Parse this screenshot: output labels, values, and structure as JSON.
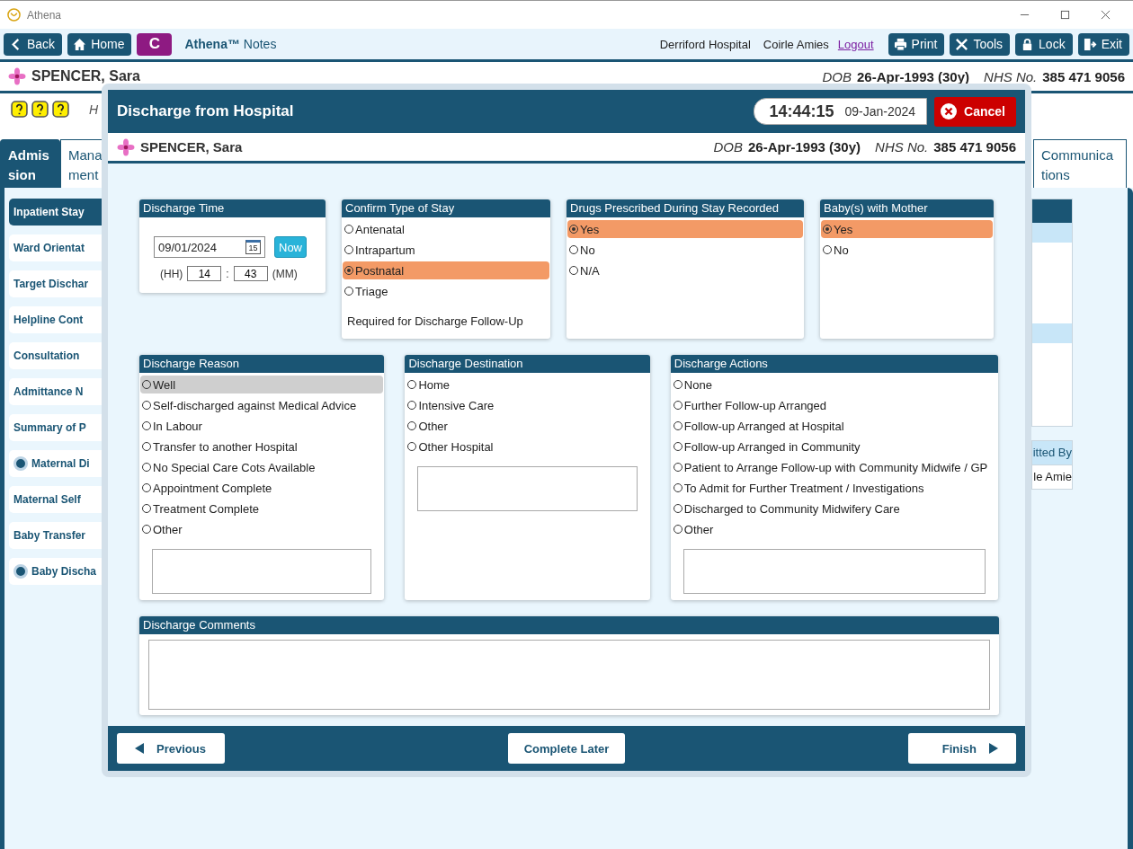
{
  "app": {
    "title": "Athena"
  },
  "toolbar": {
    "back": "Back",
    "home": "Home",
    "c": "C",
    "brand": "**Athena™** Notes",
    "hospital": "Derriford Hospital",
    "user": "Coirle Amies",
    "logout": "Logout",
    "print": "Print",
    "tools": "Tools",
    "lock": "Lock",
    "exit": "Exit"
  },
  "patient": {
    "name": "SPENCER, Sara",
    "dob_label": "DOB",
    "dob": "26-Apr-1993 (30y)",
    "nhs_label": "NHS No.",
    "nhs": "385 471 9056"
  },
  "info_row": {
    "text": "H"
  },
  "tabs": [
    {
      "label": "Admis sion",
      "selected": true
    },
    {
      "label": "Mana ment",
      "selected": false
    },
    {
      "label": "Communica tions",
      "selected": false
    }
  ],
  "sidebar": {
    "items": [
      {
        "label": "Inpatient Stay",
        "selected": true,
        "marked": false
      },
      {
        "label": "Ward Orientat",
        "selected": false,
        "marked": false
      },
      {
        "label": "Target Dischar",
        "selected": false,
        "marked": false
      },
      {
        "label": "Helpline Cont",
        "selected": false,
        "marked": false
      },
      {
        "label": "Consultation",
        "selected": false,
        "marked": false
      },
      {
        "label": "Admittance N",
        "selected": false,
        "marked": false
      },
      {
        "label": "Summary of P",
        "selected": false,
        "marked": false
      },
      {
        "label": "Maternal Di",
        "selected": false,
        "marked": true
      },
      {
        "label": "Maternal Self",
        "selected": false,
        "marked": false
      },
      {
        "label": "Baby Transfer",
        "selected": false,
        "marked": false
      },
      {
        "label": "Baby Discha",
        "selected": false,
        "marked": true
      }
    ]
  },
  "side_table": {
    "header": "itted By",
    "cell": "le Amie"
  },
  "modal": {
    "title": "Discharge from Hospital",
    "clock": {
      "time": "14:44:15",
      "date": "09-Jan-2024"
    },
    "cancel": "Cancel",
    "patient": {
      "name": "SPENCER, Sara",
      "dob_label": "DOB",
      "dob": "26-Apr-1993 (30y)",
      "nhs_label": "NHS No.",
      "nhs": "385 471 9056"
    },
    "discharge_time": {
      "title": "Discharge Time",
      "date": "09/01/2024",
      "calendar_day": "15",
      "now": "Now",
      "hh_label": "(HH)",
      "hh": "14",
      "separator": ":",
      "mm": "43",
      "mm_label": "(MM)"
    },
    "type_of_stay": {
      "title": "Confirm Type of Stay",
      "options": [
        {
          "label": "Antenatal",
          "selected": false
        },
        {
          "label": "Intrapartum",
          "selected": false
        },
        {
          "label": "Postnatal",
          "selected": true
        },
        {
          "label": "Triage",
          "selected": false
        }
      ],
      "note": "Required for Discharge Follow-Up"
    },
    "drugs": {
      "title": "Drugs Prescribed During Stay Recorded",
      "options": [
        {
          "label": "Yes",
          "selected": true
        },
        {
          "label": "No",
          "selected": false
        },
        {
          "label": "N/A",
          "selected": false
        }
      ]
    },
    "baby": {
      "title": "Baby(s) with Mother",
      "options": [
        {
          "label": "Yes",
          "selected": true
        },
        {
          "label": "No",
          "selected": false
        }
      ]
    },
    "reason": {
      "title": "Discharge Reason",
      "options": [
        {
          "label": "Well",
          "selected": false,
          "focused": true
        },
        {
          "label": "Self-discharged against Medical Advice",
          "selected": false,
          "focused": false
        },
        {
          "label": "In Labour",
          "selected": false,
          "focused": false
        },
        {
          "label": "Transfer to another Hospital",
          "selected": false,
          "focused": false
        },
        {
          "label": "No Special Care Cots Available",
          "selected": false,
          "focused": false
        },
        {
          "label": "Appointment Complete",
          "selected": false,
          "focused": false
        },
        {
          "label": "Treatment Complete",
          "selected": false,
          "focused": false
        },
        {
          "label": "Other",
          "selected": false,
          "focused": false
        }
      ]
    },
    "destination": {
      "title": "Discharge Destination",
      "options": [
        {
          "label": "Home",
          "selected": false
        },
        {
          "label": "Intensive Care",
          "selected": false
        },
        {
          "label": "Other",
          "selected": false
        },
        {
          "label": "Other Hospital",
          "selected": false
        }
      ]
    },
    "actions": {
      "title": "Discharge Actions",
      "options": [
        {
          "label": "None",
          "selected": false
        },
        {
          "label": "Further Follow-up Arranged",
          "selected": false
        },
        {
          "label": "Follow-up Arranged at Hospital",
          "selected": false
        },
        {
          "label": "Follow-up Arranged in Community",
          "selected": false
        },
        {
          "label": "Patient to Arrange Follow-up with Community Midwife / GP",
          "selected": false
        },
        {
          "label": "To Admit for Further Treatment / Investigations",
          "selected": false
        },
        {
          "label": "Discharged to Community Midwifery Care",
          "selected": false
        },
        {
          "label": "Other",
          "selected": false
        }
      ]
    },
    "comments": {
      "title": "Discharge Comments"
    },
    "footer": {
      "previous": "Previous",
      "complete_later": "Complete Later",
      "finish": "Finish"
    }
  }
}
